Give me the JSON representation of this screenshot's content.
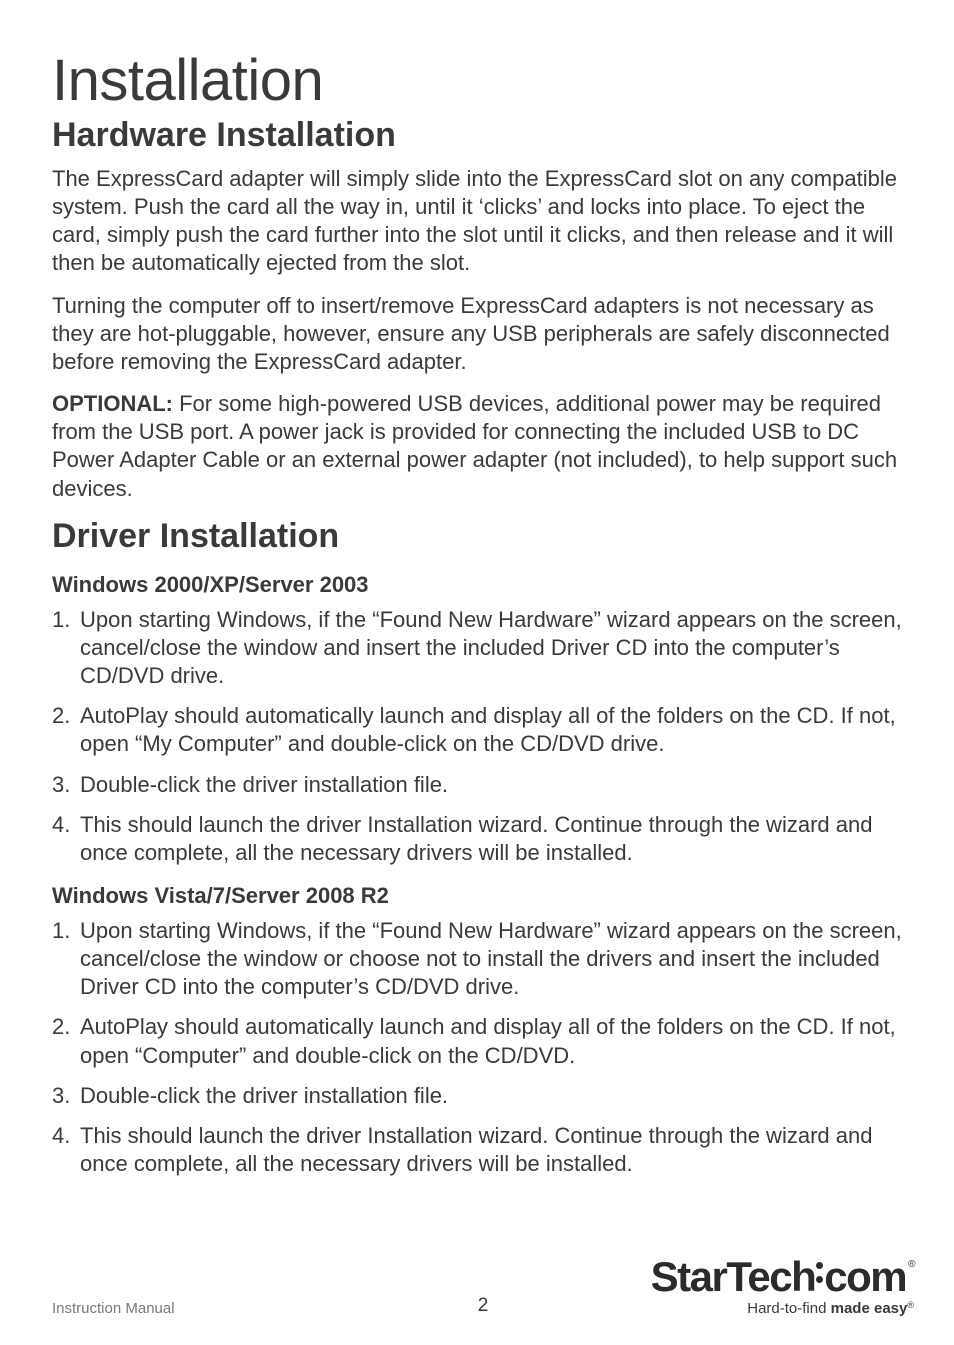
{
  "heading": "Installation",
  "hardware": {
    "title": "Hardware Installation",
    "p1": "The ExpressCard adapter will simply slide into the ExpressCard slot on any compatible system. Push the card all the way in, until it ‘clicks’ and locks into place. To eject the card, simply push the card further into the slot until it clicks, and then release and it will then be automatically ejected from the slot.",
    "p2": "Turning the computer off to insert/remove ExpressCard adapters is not necessary as they are hot-pluggable, however, ensure any USB peripherals are safely disconnected before removing the ExpressCard adapter.",
    "optional_label": "OPTIONAL:",
    "optional_text": " For some high-powered USB devices, additional power may be required from the USB port.  A power jack is provided for connecting the included USB to DC Power Adapter Cable or an external power adapter (not included), to help support such devices."
  },
  "driver": {
    "title": "Driver Installation",
    "win2000": {
      "title": "Windows 2000/XP/Server 2003",
      "steps": [
        "Upon starting Windows, if the “Found New Hardware” wizard appears on the screen, cancel/close the window and insert the included Driver CD into the computer’s CD/DVD drive.",
        "AutoPlay should automatically launch and display all of the folders on the CD.  If not, open “My Computer” and double-click on the CD/DVD drive.",
        "Double-click the driver installation file.",
        "This should launch the driver Installation wizard.  Continue through the wizard and once complete, all the necessary drivers will be installed."
      ]
    },
    "vista": {
      "title": "Windows Vista/7/Server 2008 R2",
      "steps": [
        "Upon starting Windows, if the “Found New Hardware” wizard appears on the screen, cancel/close the window or choose not to install the drivers and insert the included Driver CD into the computer’s CD/DVD drive.",
        "AutoPlay should automatically launch and display all of the folders on the CD.  If not, open “Computer” and double-click on the CD/DVD.",
        "Double-click the driver installation file.",
        "This should launch the driver Installation wizard.  Continue through the wizard and once complete, all the necessary drivers will be installed."
      ]
    }
  },
  "footer": {
    "left": "Instruction Manual",
    "page": "2",
    "logo_a": "StarTech",
    "logo_b": "com",
    "tag1": "Hard-to-find ",
    "tag2": "made easy",
    "reg": "®"
  }
}
